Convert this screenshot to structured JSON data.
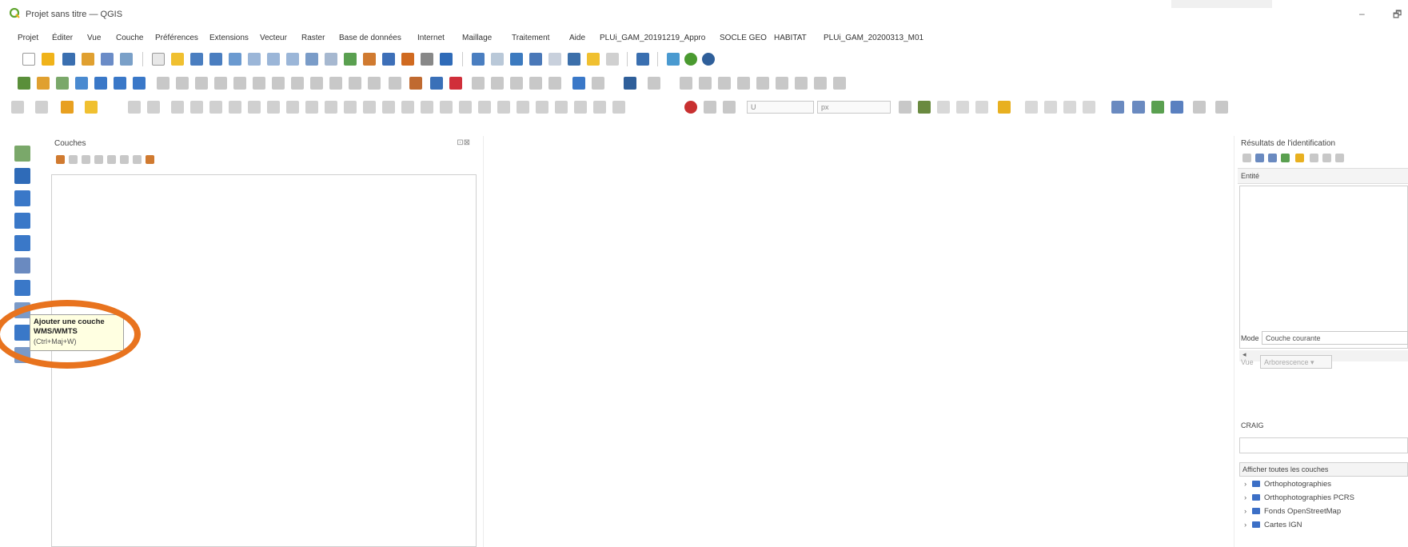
{
  "window": {
    "title": "Projet sans titre — QGIS",
    "minimize_glyph": "–",
    "restore_glyph": "🗗"
  },
  "menu": [
    "Projet",
    "Éditer",
    "Vue",
    "Couche",
    "Préférences",
    "Extensions",
    "Vecteur",
    "Raster",
    "Base de données",
    "Internet",
    "Maillage",
    "Traitement",
    "Aide",
    "PLUi_GAM_20191219_Appro",
    "SOCLE GEO",
    "HABITAT",
    "PLUi_GAM_20200313_M01"
  ],
  "toolbar3": {
    "scale_combo": "U",
    "unit_combo": "px"
  },
  "tooltip": {
    "title_line1": "Ajouter une couche",
    "title_line2": "WMS/WMTS",
    "shortcut": "(Ctrl+Maj+W)"
  },
  "layers_panel": {
    "title": "Couches",
    "close_glyph": "⊡⊠"
  },
  "ident_panel": {
    "title": "Résultats de l'identification",
    "column_header": "Entité",
    "scroll_arrow": "◂",
    "mode_label": "Mode",
    "mode_value": "Couche courante",
    "view_label": "Vue",
    "view_value": "Arborescence ▾",
    "craig_label": "CRAIG",
    "services_header": "Afficher toutes les couches",
    "services": [
      "Orthophotographies",
      "Orthophotographies PCRS",
      "Fonds OpenStreetMap",
      "Cartes IGN"
    ]
  },
  "colors": {
    "highlight": "#e8731e",
    "tooltip_bg": "#ffffe1",
    "qgis_green": "#5fa52e",
    "service_icon": "#3c6fc6"
  }
}
